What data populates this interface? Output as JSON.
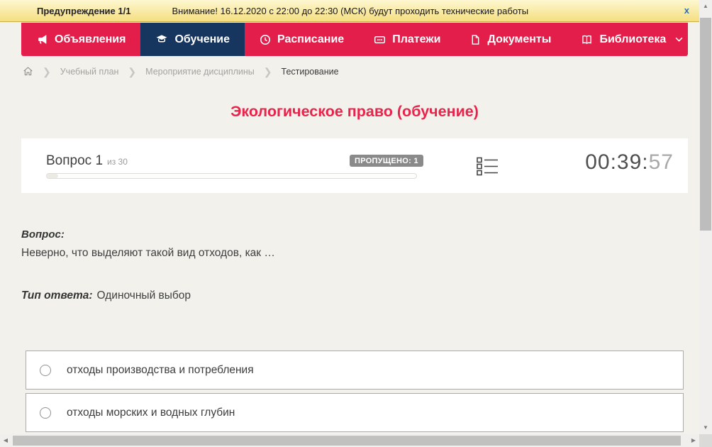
{
  "colors": {
    "nav_red": "#e31e4a",
    "active_tab_navy": "#16365f",
    "title_red": "#e8244b",
    "banner_yellow": "#f5df80",
    "badge_gray": "#8a8a8a",
    "page_bg": "#f2f1ec"
  },
  "banner": {
    "label": "Предупреждение 1/1",
    "message": "Внимание! 16.12.2020 с 22:00 до 22:30 (МСК) будут проходить технические работы",
    "close_label": "x"
  },
  "nav": {
    "items": [
      {
        "label": "Объявления",
        "icon": "megaphone-icon",
        "active": false
      },
      {
        "label": "Обучение",
        "icon": "graduation-cap-icon",
        "active": true
      },
      {
        "label": "Расписание",
        "icon": "clock-icon",
        "active": false
      },
      {
        "label": "Платежи",
        "icon": "wallet-icon",
        "active": false
      },
      {
        "label": "Документы",
        "icon": "document-icon",
        "active": false
      },
      {
        "label": "Библиотека",
        "icon": "book-icon",
        "active": false,
        "has_dropdown": true
      }
    ]
  },
  "breadcrumb": {
    "home_icon": "home-icon",
    "items": [
      "Учебный план",
      "Мероприятие дисциплины",
      "Тестирование"
    ]
  },
  "page_title": "Экологическое право (обучение)",
  "question_header": {
    "question_label": "Вопрос 1",
    "of_label": "из 30",
    "skipped_badge": "ПРОПУЩЕНО: 1",
    "progress_percent": 3,
    "question_list_icon": "question-list-icon",
    "timer_main": "00:39:",
    "timer_seconds": "57"
  },
  "question": {
    "label": "Вопрос:",
    "text": "Неверно, что выделяют такой вид отходов, как …",
    "answer_type_label": "Тип ответа:",
    "answer_type_value": "Одиночный выбор"
  },
  "answers": [
    {
      "label": "отходы производства и потребления",
      "selected": false
    },
    {
      "label": "отходы морских и водных глубин",
      "selected": false
    }
  ]
}
